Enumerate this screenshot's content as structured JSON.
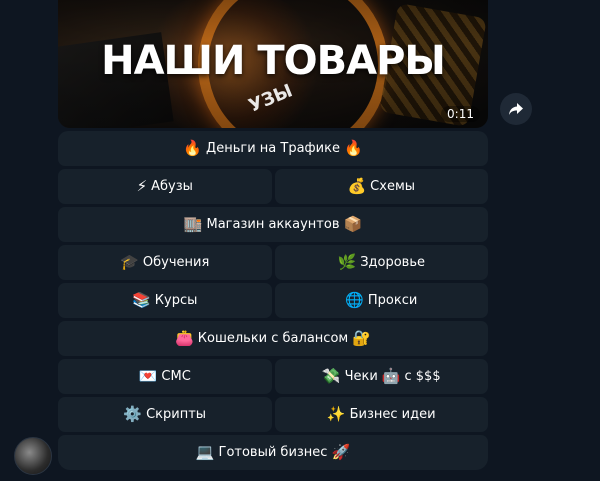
{
  "media": {
    "title": "НАШИ ТОВАРЫ",
    "tag_text": "УЗЫ",
    "duration": "0:11"
  },
  "share": {
    "icon": "share-arrow-icon"
  },
  "keyboard": {
    "rows": [
      [
        {
          "emoji": "🔥",
          "label": "Деньги на Трафике",
          "emoji2": "🔥"
        }
      ],
      [
        {
          "emoji": "⚡",
          "label": "Абузы"
        },
        {
          "emoji": "💰",
          "label": "Схемы"
        }
      ],
      [
        {
          "emoji": "🏬",
          "label": "Магазин аккаунтов",
          "emoji2": "📦"
        }
      ],
      [
        {
          "emoji": "🎓",
          "label": "Обучения"
        },
        {
          "emoji": "🌿",
          "label": "Здоровье"
        }
      ],
      [
        {
          "emoji": "📚",
          "label": "Курсы"
        },
        {
          "emoji": "🌐",
          "label": "Прокси"
        }
      ],
      [
        {
          "emoji": "👛",
          "label": "Кошельки с балансом",
          "emoji2": "🔐"
        }
      ],
      [
        {
          "emoji": "💌",
          "label": "СМС"
        },
        {
          "emoji": "💸",
          "label": "Чеки",
          "emoji2": "🤖",
          "suffix": "с $$$"
        }
      ],
      [
        {
          "emoji": "⚙️",
          "label": "Скрипты"
        },
        {
          "emoji": "✨",
          "label": "Бизнес идеи"
        }
      ],
      [
        {
          "emoji": "💻",
          "label": "Готовый бизнес",
          "emoji2": "🚀"
        }
      ]
    ]
  },
  "colors": {
    "background": "#0e1621",
    "button_bg": "#17212b",
    "text": "#ffffff"
  }
}
